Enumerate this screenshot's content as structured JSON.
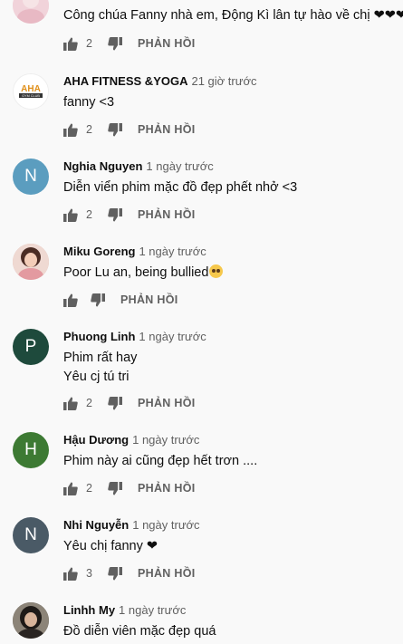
{
  "colors": {
    "background": "#f9f9f9",
    "secondary_text": "#606060",
    "icon": "#606060"
  },
  "reply_label": "PHẢN HỒI",
  "comments": [
    {
      "author": "",
      "time": "",
      "text": [
        "Công chúa Fanny nhà em, Động Kì lân tự hào về chị ❤❤❤"
      ],
      "likes": "2",
      "avatar": {
        "type": "photo",
        "color": "#e8b9c4"
      }
    },
    {
      "author": "AHA FITNESS &YOGA",
      "time": "21 giờ trước",
      "text": [
        "fanny <3"
      ],
      "likes": "2",
      "avatar": {
        "type": "logo",
        "label": "AHA",
        "sub": "GYM CLUB"
      }
    },
    {
      "author": "Nghia Nguyen",
      "time": "1 ngày trước",
      "text": [
        "Diễn viển phim mặc đồ đẹp phết nhở <3"
      ],
      "likes": "2",
      "avatar": {
        "type": "letter",
        "letter": "N",
        "color": "#5b9dbf"
      }
    },
    {
      "author": "Miku Goreng",
      "time": "1 ngày trước",
      "text": [
        "Poor Lu an, being bullied"
      ],
      "likes": "",
      "avatar": {
        "type": "photo",
        "color": "#d9a8a0"
      }
    },
    {
      "author": "Phuong Linh",
      "time": "1 ngày trước",
      "text": [
        "Phim rất hay",
        "Yêu cj tú tri"
      ],
      "likes": "2",
      "avatar": {
        "type": "letter",
        "letter": "P",
        "color": "#1e4a3c"
      }
    },
    {
      "author": "Hậu Dương",
      "time": "1 ngày trước",
      "text": [
        "Phim này ai cũng đẹp hết trơn ...."
      ],
      "likes": "2",
      "avatar": {
        "type": "letter",
        "letter": "H",
        "color": "#3d7a33"
      }
    },
    {
      "author": "Nhi Nguyễn",
      "time": "1 ngày trước",
      "text": [
        "Yêu chị fanny ❤"
      ],
      "likes": "3",
      "avatar": {
        "type": "letter",
        "letter": "N",
        "color": "#4a5a66"
      }
    },
    {
      "author": "Linhh My",
      "time": "1 ngày trước",
      "text": [
        "Đồ diễn viên mặc đẹp quá"
      ],
      "likes": "",
      "avatar": {
        "type": "photo",
        "color": "#4b4640"
      }
    }
  ]
}
